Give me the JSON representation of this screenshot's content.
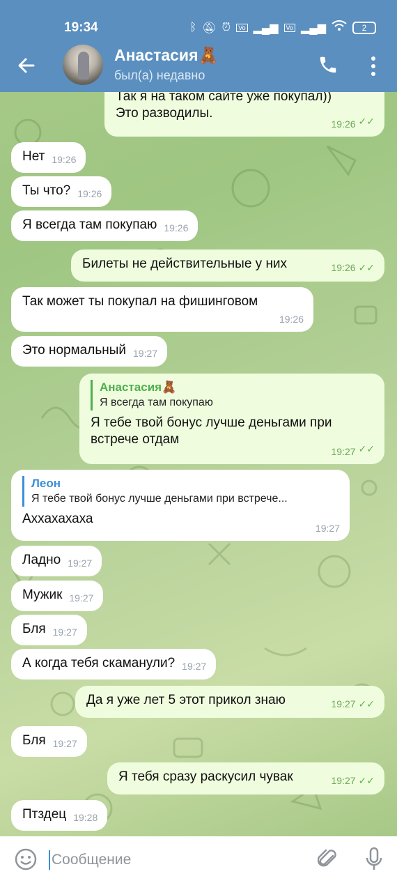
{
  "status_bar": {
    "time": "19:34",
    "battery": "2",
    "icons": [
      "bluetooth-icon",
      "mute-icon",
      "alarm-icon",
      "volte-icon",
      "signal-icon",
      "volte-icon",
      "signal-icon",
      "wifi-icon",
      "battery-icon"
    ]
  },
  "header": {
    "name": "Анастасия🧸",
    "status": "был(а) недавно",
    "color": "#5a8fbf"
  },
  "messages": [
    {
      "dir": "out",
      "text1": "Так я на таком сайте уже покупал))",
      "text2": "Это разводилы.",
      "time": "19:26"
    },
    {
      "dir": "in",
      "text": "Нет",
      "time": "19:26"
    },
    {
      "dir": "in",
      "text": "Ты что?",
      "time": "19:26"
    },
    {
      "dir": "in",
      "text": "Я всегда там покупаю",
      "time": "19:26"
    },
    {
      "dir": "out",
      "text": "Билеты не действительные у них",
      "time": "19:26"
    },
    {
      "dir": "in",
      "text": "Так может ты покупал на фишинговом",
      "time": "19:26"
    },
    {
      "dir": "in",
      "text": "Это нормальный",
      "time": "19:27"
    },
    {
      "dir": "out",
      "quote_name": "Анастасия🧸",
      "quote_text": "Я всегда там покупаю",
      "text1": "Я тебе твой бонус лучше деньгами при",
      "text2": "встрече отдам",
      "time": "19:27"
    },
    {
      "dir": "in",
      "quote_name": "Леон",
      "quote_text": "Я тебе твой бонус лучше деньгами при встрече...",
      "text": "Аххахахаха",
      "time": "19:27"
    },
    {
      "dir": "in",
      "text": "Ладно",
      "time": "19:27"
    },
    {
      "dir": "in",
      "text": "Мужик",
      "time": "19:27"
    },
    {
      "dir": "in",
      "text": "Бля",
      "time": "19:27"
    },
    {
      "dir": "in",
      "text": "А когда тебя скаманули?",
      "time": "19:27"
    },
    {
      "dir": "out",
      "text": "Да я уже лет 5 этот прикол знаю",
      "time": "19:27"
    },
    {
      "dir": "in",
      "text": "Бля",
      "time": "19:27"
    },
    {
      "dir": "out",
      "text": "Я тебя сразу раскусил чувак",
      "time": "19:27"
    },
    {
      "dir": "in",
      "text": "Птздец",
      "time": "19:28"
    }
  ],
  "input": {
    "placeholder": "Сообщение"
  },
  "colors": {
    "incoming": "#ffffff",
    "outgoing": "#effdde",
    "ticks": "#5fb34a",
    "quote_green": "#4fae4e",
    "quote_blue": "#3a8fd6"
  }
}
